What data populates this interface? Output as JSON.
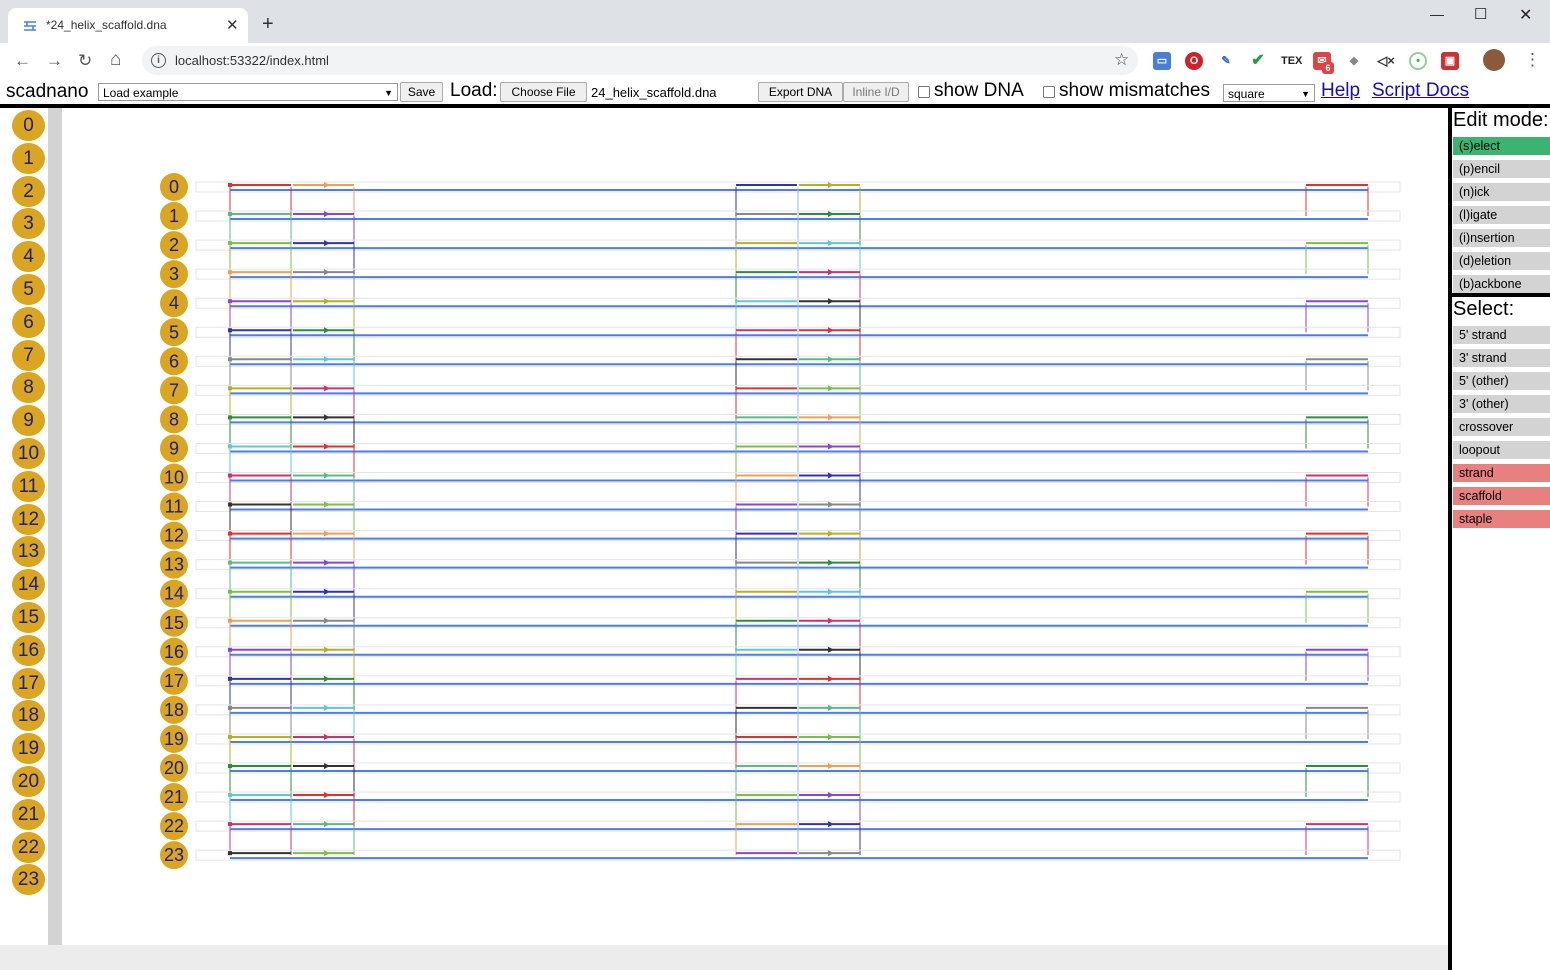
{
  "browser": {
    "tab_title": "*24_helix_scaffold.dna",
    "url": "localhost:53322/index.html",
    "ext_badge": "6"
  },
  "menubar": {
    "app_name": "scadnano",
    "example_select": "Load example",
    "save_label": "Save",
    "load_label": "Load:",
    "choose_file_label": "Choose File",
    "file_name": "24_helix_scaffold.dna",
    "export_dna_label": "Export DNA",
    "inline_id_label": "Inline I/D",
    "show_dna_label": "show DNA",
    "show_mismatches_label": "show mismatches",
    "grid_select": "square",
    "help_link": "Help",
    "script_docs_link": "Script Docs"
  },
  "side_view": {
    "helices": [
      "0",
      "1",
      "2",
      "3",
      "4",
      "5",
      "6",
      "7",
      "8",
      "9",
      "10",
      "11",
      "12",
      "13",
      "14",
      "15",
      "16",
      "17",
      "18",
      "19",
      "20",
      "21",
      "22",
      "23"
    ]
  },
  "main_view": {
    "helix_labels": [
      "0",
      "1",
      "2",
      "3",
      "4",
      "5",
      "6",
      "7",
      "8",
      "9",
      "10",
      "11",
      "12",
      "13",
      "14",
      "15",
      "16",
      "17",
      "18",
      "19",
      "20",
      "21",
      "22",
      "23"
    ],
    "scaffold_color": "#4d7ee8",
    "staple_colors": [
      "#e03030",
      "#57bb8a",
      "#7ac142",
      "#f0a050",
      "#8b46d0",
      "#3333aa",
      "#888888",
      "#b8b020",
      "#2a8f3a",
      "#5fc8d0",
      "#d03070",
      "#333333"
    ]
  },
  "panel": {
    "edit_mode_title": "Edit mode:",
    "edit_modes": [
      {
        "label": "(s)elect",
        "active": true
      },
      {
        "label": "(p)encil",
        "active": false
      },
      {
        "label": "(n)ick",
        "active": false
      },
      {
        "label": "(l)igate",
        "active": false
      },
      {
        "label": "(i)nsertion",
        "active": false
      },
      {
        "label": "(d)eletion",
        "active": false
      },
      {
        "label": "(b)ackbone",
        "active": false
      }
    ],
    "select_title": "Select:",
    "select_modes": [
      {
        "label": "5' strand",
        "active": false
      },
      {
        "label": "3' strand",
        "active": false
      },
      {
        "label": "5' (other)",
        "active": false
      },
      {
        "label": "3' (other)",
        "active": false
      },
      {
        "label": "crossover",
        "active": false
      },
      {
        "label": "loopout",
        "active": false
      },
      {
        "label": "strand",
        "active": true
      },
      {
        "label": "scaffold",
        "active": true
      },
      {
        "label": "staple",
        "active": true
      }
    ],
    "active_edit_color": "#3cb371",
    "active_select_color": "#e88080",
    "inactive_color": "#d3d3d3"
  }
}
